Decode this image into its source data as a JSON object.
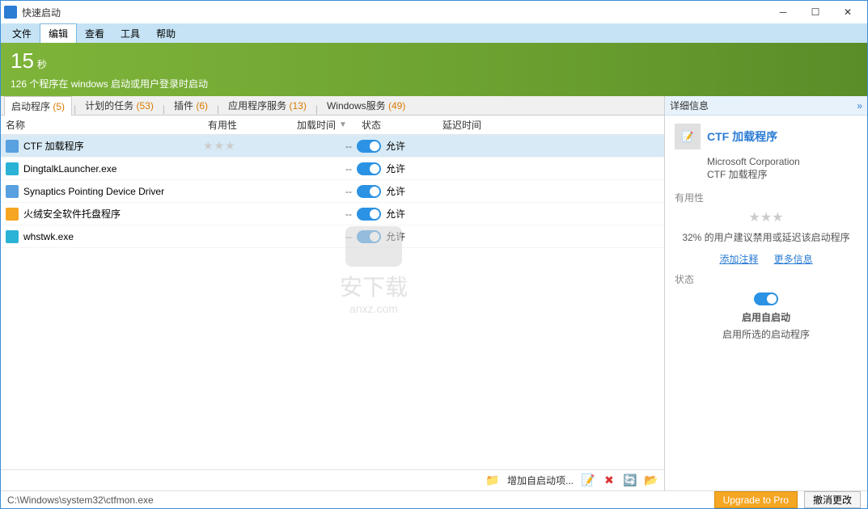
{
  "window": {
    "title": "快速启动"
  },
  "menu": {
    "file": "文件",
    "edit": "编辑",
    "view": "查看",
    "tools": "工具",
    "help": "帮助"
  },
  "summary": {
    "value": "15",
    "unit": "秒",
    "line": "126 个程序在 windows 启动或用户登录时启动"
  },
  "tabs": {
    "startup": {
      "label": "启动程序",
      "count": "(5)"
    },
    "scheduled": {
      "label": "计划的任务",
      "count": "(53)"
    },
    "plugins": {
      "label": "插件",
      "count": "(6)"
    },
    "appservices": {
      "label": "应用程序服务",
      "count": "(13)"
    },
    "winservices": {
      "label": "Windows服务",
      "count": "(49)"
    }
  },
  "columns": {
    "name": "名称",
    "usefulness": "有用性",
    "loadtime": "加载时间",
    "state": "状态",
    "delay": "延迟时间"
  },
  "rows": [
    {
      "name": "CTF 加载程序",
      "iconClass": "",
      "stars": true,
      "load": "--",
      "state": "允许"
    },
    {
      "name": "DingtalkLauncher.exe",
      "iconClass": "teal",
      "stars": false,
      "load": "--",
      "state": "允许"
    },
    {
      "name": "Synaptics Pointing Device Driver",
      "iconClass": "",
      "stars": false,
      "load": "--",
      "state": "允许"
    },
    {
      "name": "火绒安全软件托盘程序",
      "iconClass": "orange",
      "stars": false,
      "load": "--",
      "state": "允许"
    },
    {
      "name": "whstwk.exe",
      "iconClass": "teal",
      "stars": false,
      "load": "--",
      "state": "允许"
    }
  ],
  "leftFooter": {
    "addLabel": "增加自启动项..."
  },
  "details": {
    "panelTitle": "详细信息",
    "name": "CTF 加载程序",
    "vendor": "Microsoft Corporation",
    "desc": "CTF 加载程序",
    "usefulnessLabel": "有用性",
    "note": "32% 的用户建议禁用或延迟该启动程序",
    "linkAdd": "添加注释",
    "linkMore": "更多信息",
    "stateLabel": "状态",
    "statePrimary": "启用自启动",
    "stateSub": "启用所选的启动程序"
  },
  "status": {
    "path": "C:\\Windows\\system32\\ctfmon.exe",
    "upgrade": "Upgrade to Pro",
    "cancel": "撤消更改"
  },
  "watermark": {
    "text": "安下载",
    "url": "anxz.com"
  }
}
